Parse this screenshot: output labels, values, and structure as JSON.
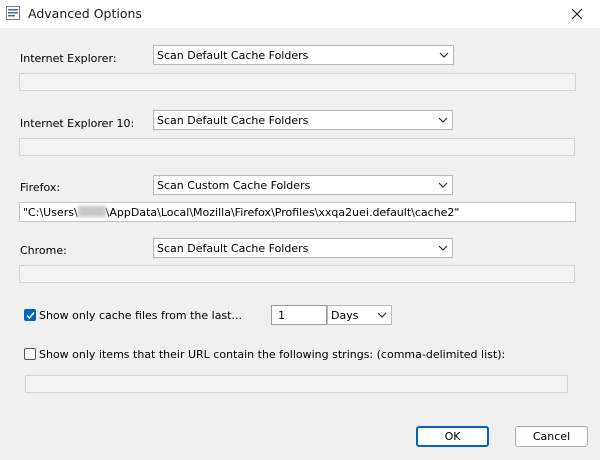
{
  "window": {
    "title": "Advanced Options"
  },
  "ie": {
    "label": "Internet Explorer:",
    "option": "Scan Default Cache Folders",
    "path": ""
  },
  "ie10": {
    "label": "Internet Explorer 10:",
    "option": "Scan Default Cache Folders",
    "path": ""
  },
  "firefox": {
    "label": "Firefox:",
    "option": "Scan Custom Cache Folders",
    "path_prefix": "\"C:\\Users\\",
    "path_suffix": "\\AppData\\Local\\Mozilla\\Firefox\\Profiles\\xxqa2uei.default\\cache2\""
  },
  "chrome": {
    "label": "Chrome:",
    "option": "Scan Default Cache Folders",
    "path": ""
  },
  "filter_last": {
    "label": "Show only cache files from the last...",
    "checked": true,
    "value": "1",
    "unit": "Days"
  },
  "filter_url": {
    "label": "Show only items that their URL contain the following strings: (comma-delimited list):",
    "checked": false,
    "value": ""
  },
  "buttons": {
    "ok": "OK",
    "cancel": "Cancel"
  },
  "colors": {
    "accent": "#0067c0",
    "background": "#f0f0f0"
  }
}
